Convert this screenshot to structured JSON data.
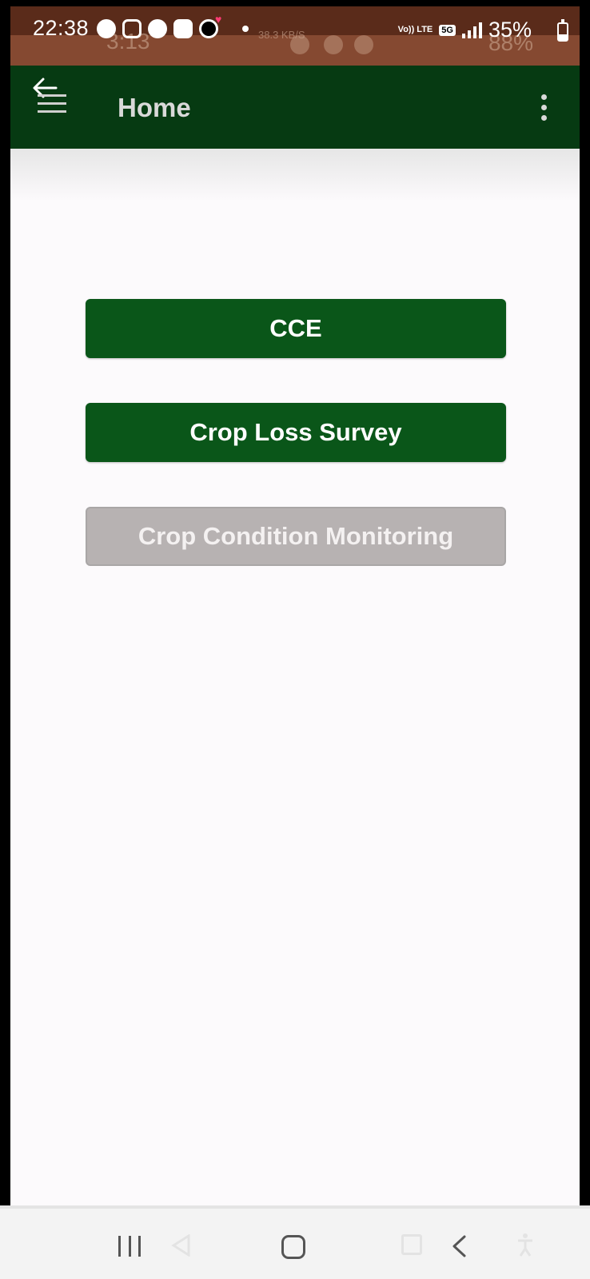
{
  "status_bar": {
    "time": "22:38",
    "battery_percent": "35%",
    "network": "5G",
    "volte": "Vo)) LTE",
    "ghost_time": "3:13",
    "ghost_rate": "38.3 KB/S",
    "ghost_battery": "88%"
  },
  "app_bar": {
    "title": "Home"
  },
  "menu": {
    "cce_label": "CCE",
    "crop_loss_label": "Crop Loss Survey",
    "crop_condition_label": "Crop Condition Monitoring",
    "crop_condition_enabled": false
  },
  "colors": {
    "app_bar": "#063a12",
    "primary_button": "#0a5619",
    "disabled_button": "#b7b2b2",
    "background": "#fcfafc"
  },
  "icons": [
    "back-arrow-icon",
    "hamburger-menu-icon",
    "overflow-menu-icon",
    "recents-icon",
    "home-icon",
    "back-icon"
  ]
}
